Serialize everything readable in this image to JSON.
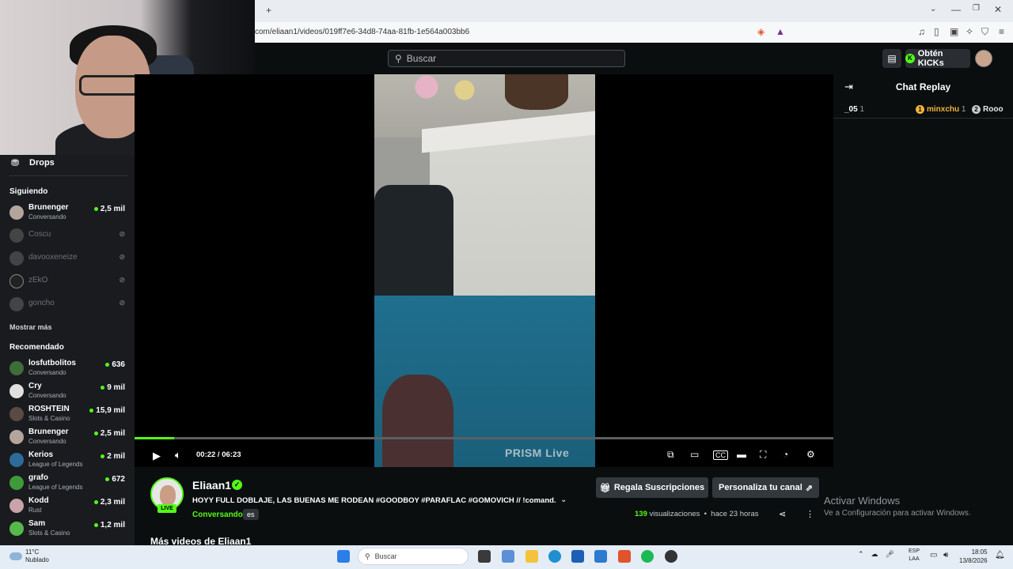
{
  "browser": {
    "url": "com/eliaan1/videos/019ff7e6-34d8-74aa-81fb-1e564a003bb6",
    "new_tab": "+"
  },
  "header": {
    "search_placeholder": "Buscar",
    "kicks_label": "Obtén KICKs",
    "kicks_badge": "K"
  },
  "sidebar": {
    "drops_label": "Drops",
    "following_title": "Siguiendo",
    "following": [
      {
        "name": "Brunenger",
        "category": "Conversando",
        "viewers": "2,5 mil",
        "live": true
      },
      {
        "name": "Coscu",
        "live": false
      },
      {
        "name": "davooxeneize",
        "live": false
      },
      {
        "name": "zEkO",
        "live": false
      },
      {
        "name": "goncho",
        "live": false
      }
    ],
    "show_more": "Mostrar más",
    "recommended_title": "Recomendado",
    "recommended": [
      {
        "name": "losfutbolitos",
        "category": "Conversando",
        "viewers": "636"
      },
      {
        "name": "Cry",
        "category": "Conversando",
        "viewers": "9 mil"
      },
      {
        "name": "ROSHTEIN",
        "category": "Slots & Casino",
        "viewers": "15,9 mil"
      },
      {
        "name": "Brunenger",
        "category": "Conversando",
        "viewers": "2,5 mil"
      },
      {
        "name": "Kerios",
        "category": "League of Legends",
        "viewers": "2 mil"
      },
      {
        "name": "grafo",
        "category": "League of Legends",
        "viewers": "672"
      },
      {
        "name": "Kodd",
        "category": "Rust",
        "viewers": "2,3 mil"
      },
      {
        "name": "Sam",
        "category": "Slots & Casino",
        "viewers": "1,2 mil"
      }
    ]
  },
  "player": {
    "time_current": "00:22",
    "time_total": "06:23",
    "time_display": "00:22 / 06:23",
    "progress_fraction": 0.057,
    "watermark": "PRISM Live"
  },
  "chat": {
    "title": "Chat Replay",
    "entries": [
      {
        "user": "_05",
        "count": "1"
      },
      {
        "badge": "1",
        "user": "minxchu",
        "count": "1"
      },
      {
        "badge": "2",
        "user": "Rooo"
      }
    ]
  },
  "channel": {
    "name": "Eliaan1",
    "live_badge": "LIVE",
    "stream_title": "HOYY FULL DOBLAJE, LAS BUENAS ME RODEAN #GOODBOY #PARAFLAC #GOMOVICH // !comand...",
    "category": "Conversando",
    "language": "es",
    "subs_button": "Regala Suscripciones",
    "customize_button": "Personaliza tu canal",
    "views_count": "139",
    "views_label": "visualizaciones",
    "age": "hace 23 horas",
    "more_videos": "Más videos de Eliaan1"
  },
  "windows_activation": {
    "line1": "Activar Windows",
    "line2": "Ve a Configuración para activar Windows."
  },
  "taskbar": {
    "temp": "11°C",
    "weather": "Nublado",
    "search": "Buscar",
    "lang_line1": "ESP",
    "lang_line2": "LAA",
    "time": "18:05",
    "date": "13/8/2026"
  },
  "colors": {
    "accent": "#53fc18",
    "bg": "#0b0e0f",
    "sidebar": "#191b1f"
  }
}
